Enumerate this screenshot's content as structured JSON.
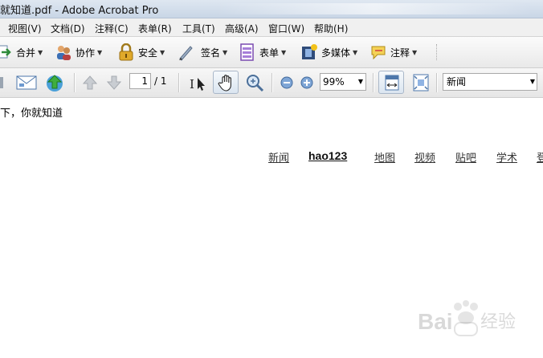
{
  "window": {
    "title": "就知道.pdf - Adobe Acrobat Pro"
  },
  "menu": [
    "视图(V)",
    "文档(D)",
    "注释(C)",
    "表单(R)",
    "工具(T)",
    "高级(A)",
    "窗口(W)",
    "帮助(H)"
  ],
  "toolbar": {
    "merge": "合并",
    "collaborate": "协作",
    "secure": "安全",
    "sign": "签名",
    "forms": "表单",
    "multimedia": "多媒体",
    "comment": "注释"
  },
  "nav": {
    "page_current": "1",
    "page_total": "/ 1",
    "zoom": "99%",
    "search_value": "新闻"
  },
  "document": {
    "line": "下，你就知道",
    "links": [
      "新闻",
      "hao123",
      "地图",
      "视频",
      "贴吧",
      "学术",
      "登"
    ]
  },
  "watermark": {
    "text": "Bai",
    "text2": "经验"
  },
  "colors": {
    "accent": "#3a6fb0",
    "link": "#333333"
  }
}
